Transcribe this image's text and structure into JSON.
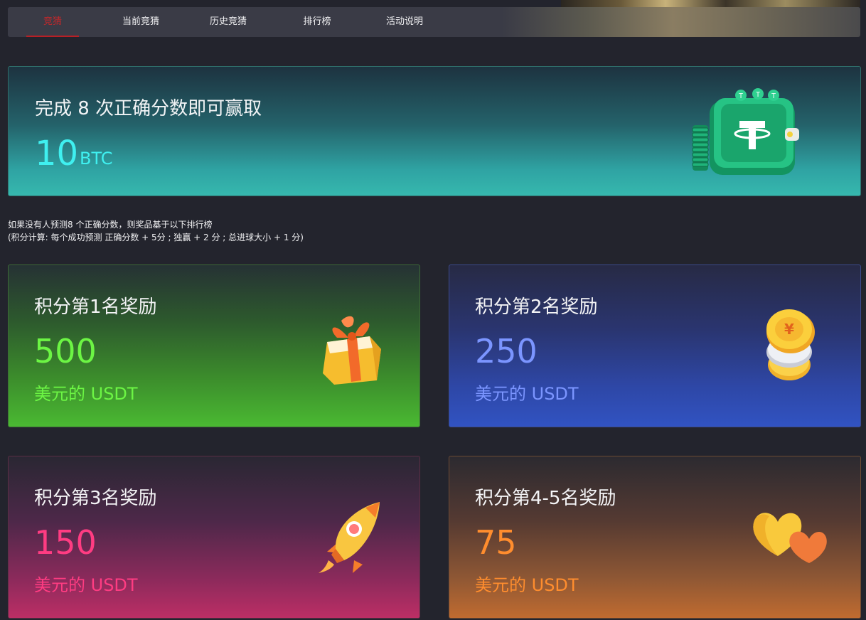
{
  "nav": {
    "tabs": [
      {
        "label": "竞猜",
        "active": true
      },
      {
        "label": "当前竞猜",
        "active": false
      },
      {
        "label": "历史竞猜",
        "active": false
      },
      {
        "label": "排行榜",
        "active": false
      },
      {
        "label": "活动说明",
        "active": false
      }
    ]
  },
  "hero": {
    "title": "完成 8 次正确分数即可赢取",
    "amount": "10",
    "unit": "BTC",
    "icon": "tether-wallet-icon"
  },
  "note": {
    "line1": "如果没有人预测8 个正确分数，则奖品基于以下排行榜",
    "line2": "(积分计算: 每个成功预测 正确分数 + 5分 ; 独赢 + 2 分 ; 总进球大小 + 1 分)"
  },
  "cards": [
    {
      "title": "积分第1名奖励",
      "value": "500",
      "unit": "美元的 USDT",
      "icon": "gift-box-icon",
      "accent": "#6cf544"
    },
    {
      "title": "积分第2名奖励",
      "value": "250",
      "unit": "美元的 USDT",
      "icon": "coin-stack-icon",
      "accent": "#7b95ff"
    },
    {
      "title": "积分第3名奖励",
      "value": "150",
      "unit": "美元的 USDT",
      "icon": "rocket-icon",
      "accent": "#ff3c82"
    },
    {
      "title": "积分第4-5名奖励",
      "value": "75",
      "unit": "美元的 USDT",
      "icon": "hearts-icon",
      "accent": "#ff8d2e"
    }
  ]
}
